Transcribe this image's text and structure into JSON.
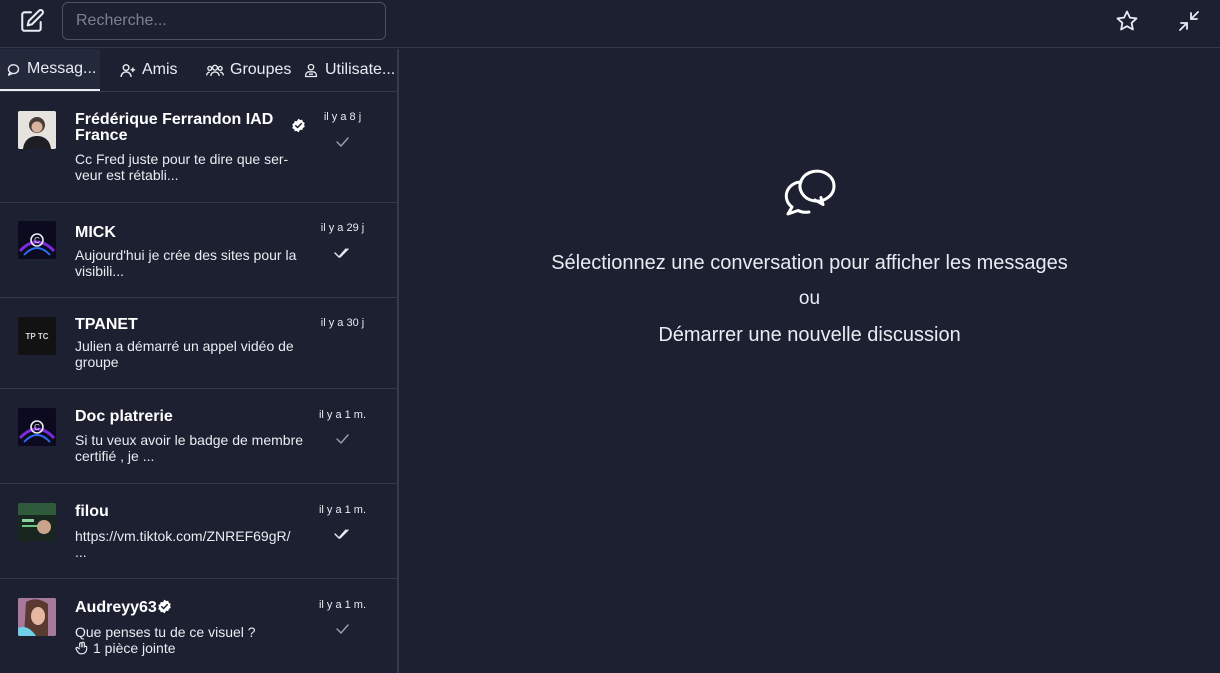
{
  "search": {
    "placeholder": "Recherche..."
  },
  "tabs": [
    {
      "label": "Messag...",
      "icon": "chat-icon"
    },
    {
      "label": "Amis",
      "icon": "user-icon"
    },
    {
      "label": "Groupes",
      "icon": "group-icon"
    },
    {
      "label": "Utilisate...",
      "icon": "users-icon"
    }
  ],
  "conversations": [
    {
      "name": "Frédérique Ferrandon IAD France",
      "verified": true,
      "preview": "Cc Fred juste pour te dire que ser-veur est rétabli...",
      "time": "il y a 8 j",
      "status": "sent"
    },
    {
      "name": "MICK",
      "verified": false,
      "preview": "Aujourd'hui je crée des sites pour la visibili...",
      "time": "il y a 29 j",
      "status": "read"
    },
    {
      "name": "TPANET",
      "verified": false,
      "preview": "Julien a démarré un appel vidéo de groupe",
      "time": "il y a 30 j",
      "status": "none"
    },
    {
      "name": "Doc platrerie",
      "verified": false,
      "preview": "Si tu veux avoir le badge de membre certifié , je ...",
      "time": "il y a 1 m.",
      "status": "sent"
    },
    {
      "name": "filou",
      "verified": false,
      "preview": "https://vm.tiktok.com/ZNREF69gR/ ...",
      "time": "il y a 1 m.",
      "status": "read"
    },
    {
      "name": "Audreyy63",
      "verified": true,
      "preview": "Que penses tu de ce visuel ?",
      "attachment": "1 pièce jointe",
      "time": "il y a 1 m.",
      "status": "sent"
    }
  ],
  "empty_state": {
    "line1": "Sélectionnez une conversation pour afficher les messages",
    "line2": "ou",
    "line3": "Démarrer une nouvelle discussion"
  },
  "colors": {
    "background": "#1c2030",
    "border": "#343a4c",
    "text": "#e9ecf2",
    "muted": "#9aa0b0"
  }
}
